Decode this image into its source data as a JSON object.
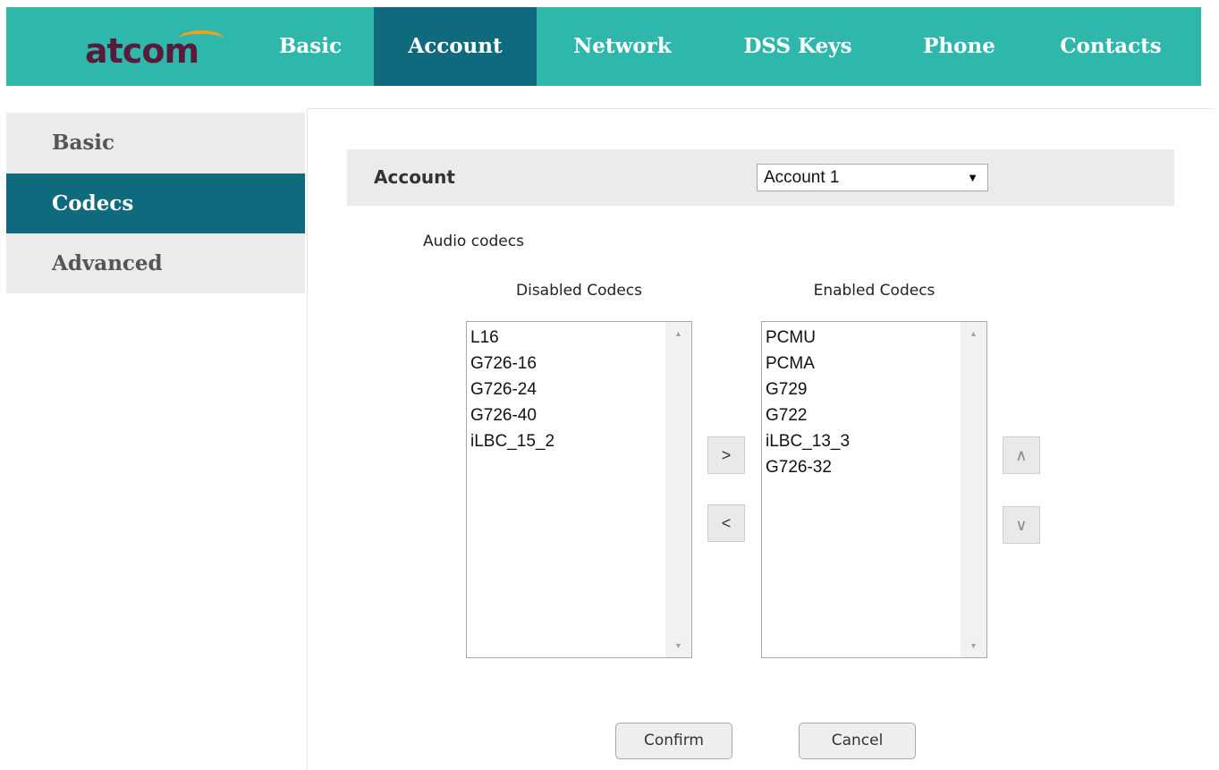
{
  "brand": {
    "logo_text": "atcom",
    "logo_colors": {
      "text": "#5a1a3a",
      "swoosh": "#f0a020"
    }
  },
  "colors": {
    "topbar": "#2fb7ac",
    "active": "#0f6a7d",
    "panel": "#ebebeb"
  },
  "nav": {
    "items": [
      {
        "label": "Basic",
        "active": false
      },
      {
        "label": "Account",
        "active": true
      },
      {
        "label": "Network",
        "active": false
      },
      {
        "label": "DSS Keys",
        "active": false
      },
      {
        "label": "Phone",
        "active": false
      },
      {
        "label": "Contacts",
        "active": false
      }
    ]
  },
  "sidebar": {
    "items": [
      {
        "label": "Basic",
        "active": false
      },
      {
        "label": "Codecs",
        "active": true
      },
      {
        "label": "Advanced",
        "active": false
      }
    ]
  },
  "account_bar": {
    "label": "Account",
    "selected": "Account 1",
    "arrow": "▼"
  },
  "audio_codecs": {
    "section_label": "Audio codecs",
    "disabled_label": "Disabled Codecs",
    "enabled_label": "Enabled Codecs",
    "disabled": [
      "L16",
      "G726-16",
      "G726-24",
      "G726-40",
      "iLBC_15_2"
    ],
    "enabled": [
      "PCMU",
      "PCMA",
      "G729",
      "G722",
      "iLBC_13_3",
      "G726-32"
    ],
    "scroll_up": "▲",
    "scroll_down": "▼"
  },
  "buttons": {
    "move_right": ">",
    "move_left": "<",
    "move_up": "∧",
    "move_down": "∨",
    "confirm": "Confirm",
    "cancel": "Cancel"
  }
}
